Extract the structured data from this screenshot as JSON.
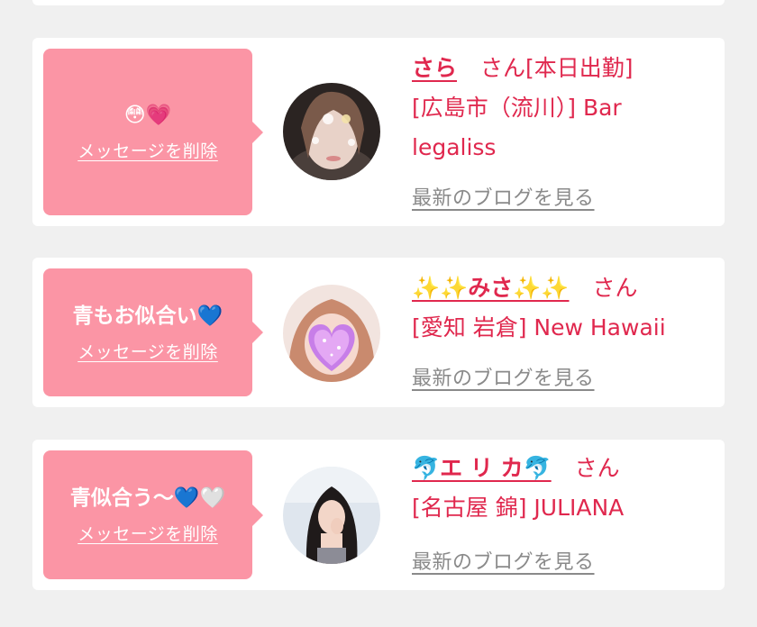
{
  "colors": {
    "accent": "#e0284e",
    "bubble": "#fb95a5",
    "link_gray": "#8a8a8a",
    "background": "#f0f0f0"
  },
  "common": {
    "san": "さん",
    "delete_label": "メッセージを削除",
    "blog_label": "最新のブログを見る"
  },
  "cards": [
    {
      "message": "😳💗",
      "name": "さら",
      "info_line1": "[本日出勤]",
      "info_line2": "[広島市（流川）] Bar",
      "info_line3": "legaliss"
    },
    {
      "message": "青もお似合い💙",
      "name": "✨✨みさ✨✨",
      "info_line2": "[愛知 岩倉] New Hawaii"
    },
    {
      "message": "青似合う〜💙🤍",
      "name": "🐬エ リ カ🐬",
      "info_line2": "[名古屋 錦] JULIANA"
    }
  ]
}
